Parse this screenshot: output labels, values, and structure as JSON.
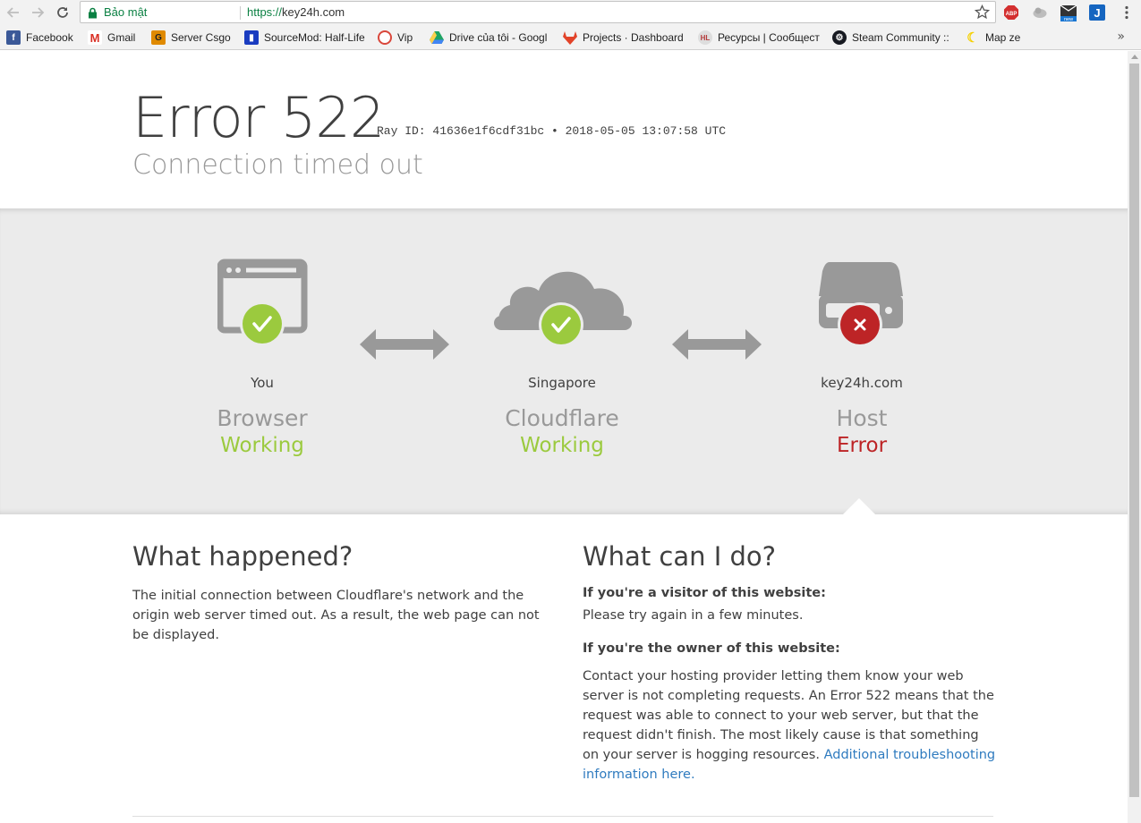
{
  "browser": {
    "secure_label": "Bảo mật",
    "url_scheme": "https://",
    "url_host": "key24h.com"
  },
  "bookmarks": [
    {
      "label": "Facebook",
      "icon": "facebook-icon",
      "color": "#3b5998"
    },
    {
      "label": "Gmail",
      "icon": "gmail-icon",
      "color": "#d93025"
    },
    {
      "label": "Server Csgo",
      "icon": "csgo-icon",
      "color": "#e08a00"
    },
    {
      "label": "SourceMod: Half-Life",
      "icon": "sourcemod-icon",
      "color": "#1a3cc0"
    },
    {
      "label": "Vip",
      "icon": "vip-icon",
      "color": "#d9473b"
    },
    {
      "label": "Drive của tôi - Googl",
      "icon": "drive-icon",
      "color": "#1fa463"
    },
    {
      "label": "Projects · Dashboard",
      "icon": "gitlab-icon",
      "color": "#e24329"
    },
    {
      "label": "Ресурсы | Сообщест",
      "icon": "hlmod-icon",
      "color": "#b43a3a"
    },
    {
      "label": "Steam Community ::",
      "icon": "steam-icon",
      "color": "#171a21"
    },
    {
      "label": "Map ze",
      "icon": "banana-icon",
      "color": "#f5d000"
    }
  ],
  "error": {
    "code": "Error 522",
    "ray": "Ray ID: 41636e1f6cdf31bc • 2018-05-05 13:07:58 UTC",
    "title": "Connection timed out"
  },
  "nodes": [
    {
      "location": "You",
      "name": "Browser",
      "status": "Working",
      "state": "ok"
    },
    {
      "location": "Singapore",
      "name": "Cloudflare",
      "status": "Working",
      "state": "ok"
    },
    {
      "location": "key24h.com",
      "name": "Host",
      "status": "Error",
      "state": "error"
    }
  ],
  "colors": {
    "ok": "#9bca3e",
    "error": "#bd2426",
    "icon_gray": "#999999",
    "link": "#2f7bbf"
  },
  "what_happened": {
    "heading": "What happened?",
    "text": "The initial connection between Cloudflare's network and the origin web server timed out. As a result, the web page can not be displayed."
  },
  "what_can_i_do": {
    "heading": "What can I do?",
    "visitor_heading": "If you're a visitor of this website:",
    "visitor_text": "Please try again in a few minutes.",
    "owner_heading": "If you're the owner of this website:",
    "owner_text": "Contact your hosting provider letting them know your web server is not completing requests. An Error 522 means that the request was able to connect to your web server, but that the request didn't finish. The most likely cause is that something on your server is hogging resources. ",
    "owner_link": "Additional troubleshooting information here."
  }
}
